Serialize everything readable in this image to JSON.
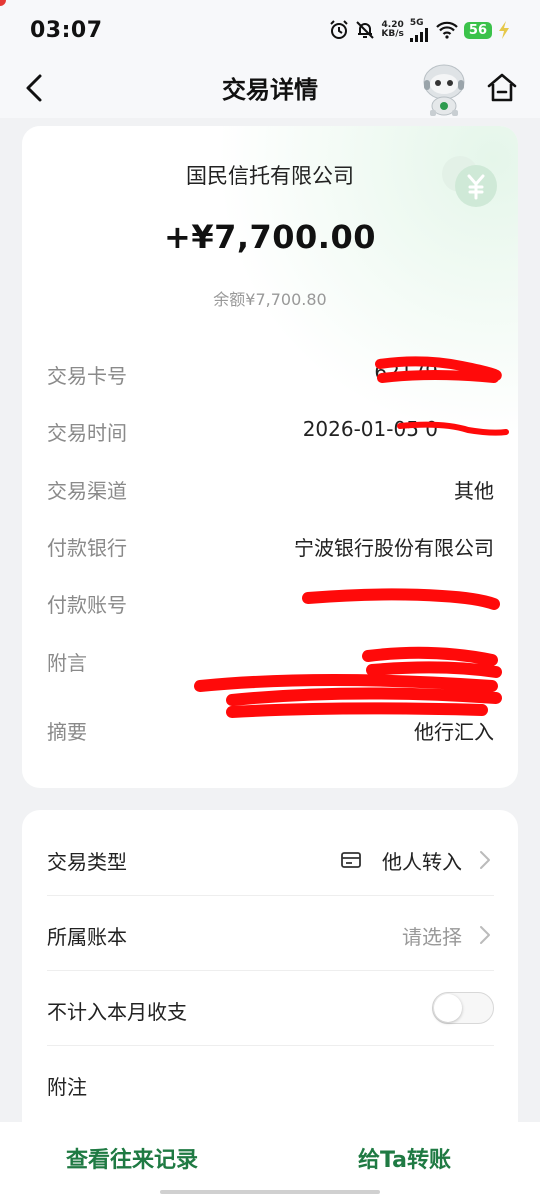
{
  "status_bar": {
    "time": "03:07",
    "net_speed_value": "4.20",
    "net_speed_unit": "KB/s",
    "network": "5G",
    "battery": "56"
  },
  "nav": {
    "title": "交易详情"
  },
  "summary": {
    "company": "国民信托有限公司",
    "amount": "+¥7,700.00",
    "balance": "余额¥7,700.80"
  },
  "details": [
    {
      "label": "交易卡号",
      "value": "62179"
    },
    {
      "label": "交易时间",
      "value": "2026-01-05 0"
    },
    {
      "label": "交易渠道",
      "value": "其他"
    },
    {
      "label": "付款银行",
      "value": "宁波银行股份有限公司"
    },
    {
      "label": "付款账号",
      "value": ""
    },
    {
      "label": "附言",
      "value": ""
    },
    {
      "label": "摘要",
      "value": "他行汇入"
    }
  ],
  "settings": {
    "type_label": "交易类型",
    "type_value": "他人转入",
    "book_label": "所属账本",
    "book_value": "请选择",
    "exclude_label": "不计入本月收支",
    "exclude_on": false,
    "note_label": "附注"
  },
  "bottom": {
    "history_label": "查看往来记录",
    "transfer_label": "给Ta转账"
  },
  "colors": {
    "accent": "#1f7a43",
    "scribble": "#ff0a0a"
  }
}
